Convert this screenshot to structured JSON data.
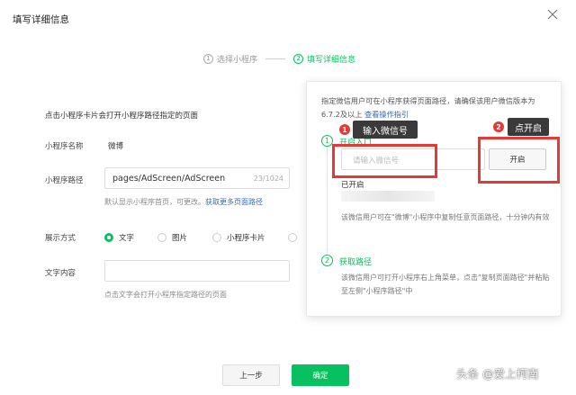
{
  "dialog": {
    "title": "填写详细信息"
  },
  "steps": [
    {
      "num": "1",
      "label": "选择小程序"
    },
    {
      "num": "2",
      "label": "填写详细信息"
    }
  ],
  "form": {
    "description": "点击小程序卡片会打开小程序路径指定的页面",
    "name_label": "小程序名称",
    "name_value": "微博",
    "path_label": "小程序路径",
    "path_value": "pages/AdScreen/AdScreen",
    "path_count": "23/1024",
    "path_hint": "默认显示小程序首页，可更改。",
    "path_hint_link": "获取更多页面路径",
    "display_label": "展示方式",
    "display_options": [
      "文字",
      "图片",
      "小程序卡片"
    ],
    "display_selected": "文字",
    "content_label": "文字内容",
    "content_value": "",
    "content_hint": "点击文字会打开小程序指定路径的页面"
  },
  "popover": {
    "intro": "指定微信用户可在小程序获得页面路径，请确保该用户微信版本为6.7.2及以上",
    "intro_link": "查看操作指引",
    "section1": {
      "num": "1",
      "title": "开启入口"
    },
    "wechat_input_placeholder": "请输入微信号",
    "open_button": "开启",
    "opened_label": "已开启",
    "note1": "该微信用户可在\"微博\"小程序中复制任意页面路径，十分钟内有效",
    "section2": {
      "num": "2",
      "title": "获取路径"
    },
    "note2": "该微信用户可打开小程序右上角菜单，点击\"复制页面路径\"并粘贴至左侧\"小程序路径\"中"
  },
  "annotations": {
    "badge1": "1",
    "tip1": "输入微信号",
    "badge2": "2",
    "tip2": "点开启"
  },
  "footer": {
    "prev_button": "上一步",
    "confirm_button": "确定"
  },
  "watermark": "头条 @爱上柯南",
  "colors": {
    "accent": "#07c160",
    "link": "#3e6aa8",
    "annotation_red": "#e53935"
  }
}
